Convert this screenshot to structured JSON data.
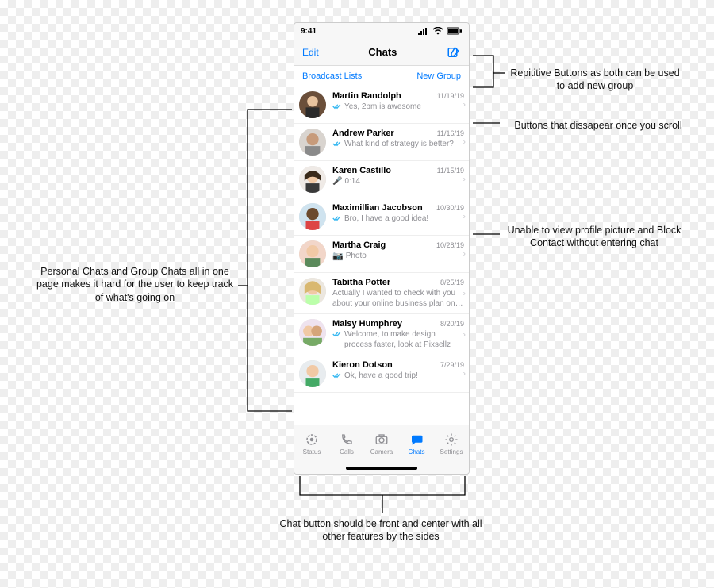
{
  "statusbar": {
    "time": "9:41"
  },
  "navbar": {
    "edit": "Edit",
    "title": "Chats"
  },
  "subheader": {
    "broadcast": "Broadcast Lists",
    "newgroup": "New Group"
  },
  "chats": [
    {
      "name": "Martin Randolph",
      "date": "11/19/19",
      "read": true,
      "preview": "Yes, 2pm is awesome",
      "kind": "text"
    },
    {
      "name": "Andrew Parker",
      "date": "11/16/19",
      "read": true,
      "preview": "What kind of strategy is better?",
      "kind": "text"
    },
    {
      "name": "Karen Castillo",
      "date": "11/15/19",
      "read": false,
      "preview": "0:14",
      "kind": "voice"
    },
    {
      "name": "Maximillian Jacobson",
      "date": "10/30/19",
      "read": true,
      "preview": "Bro, I have a good idea!",
      "kind": "text"
    },
    {
      "name": "Martha Craig",
      "date": "10/28/19",
      "read": false,
      "preview": "Photo",
      "kind": "photo"
    },
    {
      "name": "Tabitha Potter",
      "date": "8/25/19",
      "read": false,
      "preview": "Actually I wanted to check with you about your online business plan on our…",
      "kind": "text"
    },
    {
      "name": "Maisy Humphrey",
      "date": "8/20/19",
      "read": true,
      "preview": "Welcome, to make design process faster, look at Pixsellz",
      "kind": "text"
    },
    {
      "name": "Kieron Dotson",
      "date": "7/29/19",
      "read": true,
      "preview": "Ok, have a good trip!",
      "kind": "text"
    }
  ],
  "tabs": {
    "status": "Status",
    "calls": "Calls",
    "camera": "Camera",
    "chats": "Chats",
    "settings": "Settings"
  },
  "annotations": {
    "left_mix": "Personal Chats and Group Chats all in one page makes it hard for the user to keep track of what's going on",
    "top_repeat": "Repititive Buttons as both can be used to add new group",
    "scroll_disappear": "Buttons that dissapear once you scroll",
    "profile_block": "Unable to view profile picture and Block Contact without entering chat",
    "bottom_center": "Chat button should be front and center with all other features by the sides"
  }
}
